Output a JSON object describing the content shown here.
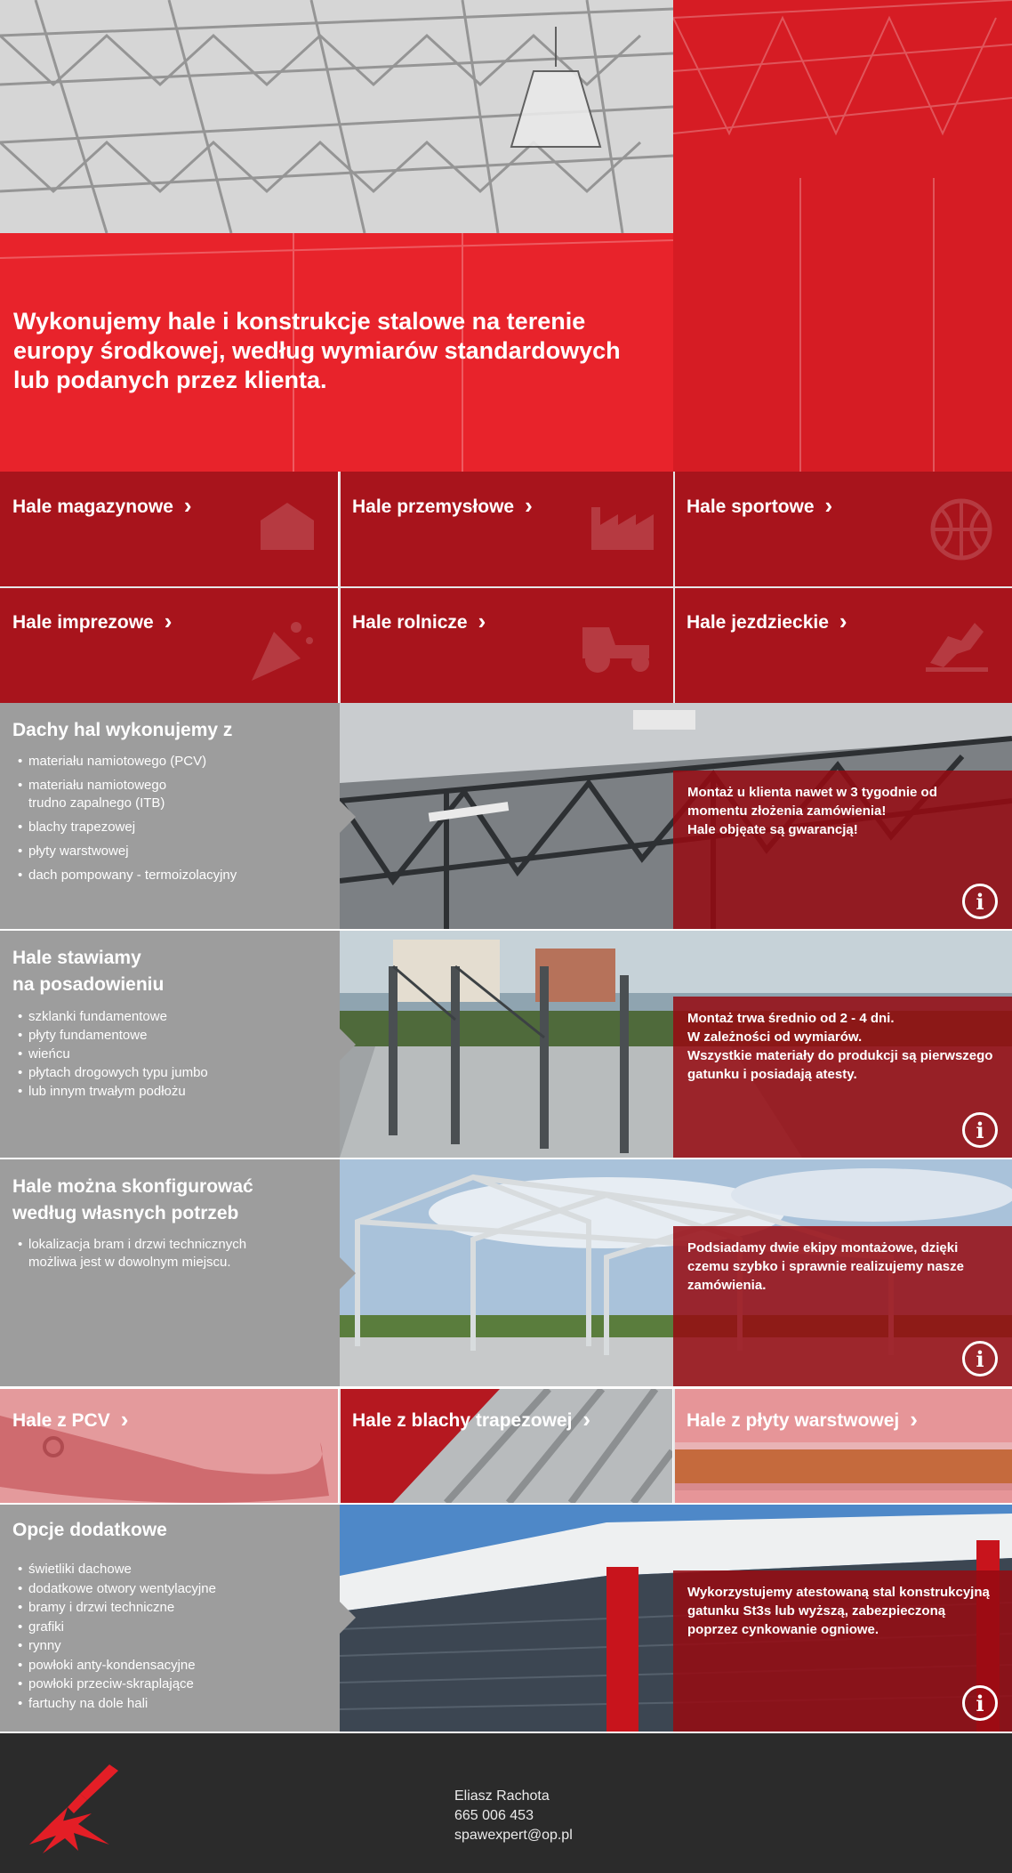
{
  "hero": {
    "title": "Wykonujemy hale i konstrukcje stalowe na terenie europy środkowej, według wymiarów standardowych lub podanych przez klienta."
  },
  "categories": [
    {
      "label": "Hale magazynowe",
      "icon": "warehouse-icon"
    },
    {
      "label": "Hale przemysłowe",
      "icon": "factory-icon"
    },
    {
      "label": "Hale sportowe",
      "icon": "basketball-icon"
    },
    {
      "label": "Hale imprezowe",
      "icon": "party-icon"
    },
    {
      "label": "Hale rolnicze",
      "icon": "tractor-icon"
    },
    {
      "label": "Hale jezdzieckie",
      "icon": "horse-jump-icon"
    }
  ],
  "roofs": {
    "title": "Dachy hal wykonujemy z",
    "items": [
      "materiału namiotowego (PCV)",
      "materiału namiotowego\ntrudno zapalnego (ITB)",
      "blachy trapezowej",
      "płyty warstwowej",
      "dach pompowany - termoizolacyjny"
    ],
    "overlay": "Montaż u klienta nawet w 3 tygodnie od momentu złożenia zamówienia!\nHale objęate są gwarancją!"
  },
  "foundation": {
    "title": "Hale stawiamy\nna posadowieniu",
    "items": [
      "szklanki fundamentowe",
      "płyty fundamentowe",
      "wieńcu",
      "płytach drogowych typu jumbo",
      "lub innym trwałym podłożu"
    ],
    "overlay": "Montaż trwa średnio od 2 - 4 dni.\nW zależności od wymiarów.\nWszystkie materiały do produkcji są pierwszego gatunku i posiadają atesty."
  },
  "config": {
    "title": "Hale można skonfigurować\nwedług własnych potrzeb",
    "items": [
      "lokalizacja bram i drzwi technicznych\nmożliwa jest w dowolnym miejscu."
    ],
    "overlay": "Podsiadamy dwie ekipy montażowe, dzięki czemu szybko i sprawnie realizujemy nasze zamówienia."
  },
  "materials": [
    {
      "label": "Hale z PCV"
    },
    {
      "label": "Hale z blachy trapezowej"
    },
    {
      "label": "Hale z płyty warstwowej"
    }
  ],
  "extras": {
    "title": "Opcje dodatkowe",
    "items": [
      "świetliki dachowe",
      "dodatkowe otwory wentylacyjne",
      "bramy i drzwi techniczne",
      "grafiki",
      "rynny",
      "powłoki anty-kondensacyjne",
      "powłoki przeciw-skraplające",
      "fartuchy na dole hali"
    ],
    "overlay": "Wykorzystujemy atestowaną stal konstrukcyjną gatunku St3s lub wyższą, zabezpieczoną poprzez cynkowanie ogniowe."
  },
  "info_icon": "info-icon",
  "chevron_icon": "chevron-right-icon",
  "footer": {
    "name": "Eliasz Rachota",
    "phone": "665 006 453",
    "email": "spawexpert@op.pl",
    "logo": "welding-torch-logo"
  },
  "colors": {
    "brand_red": "#e41e26",
    "dark_red": "#a8141c",
    "gray": "#9d9d9d",
    "footer": "#2b2b2b"
  }
}
